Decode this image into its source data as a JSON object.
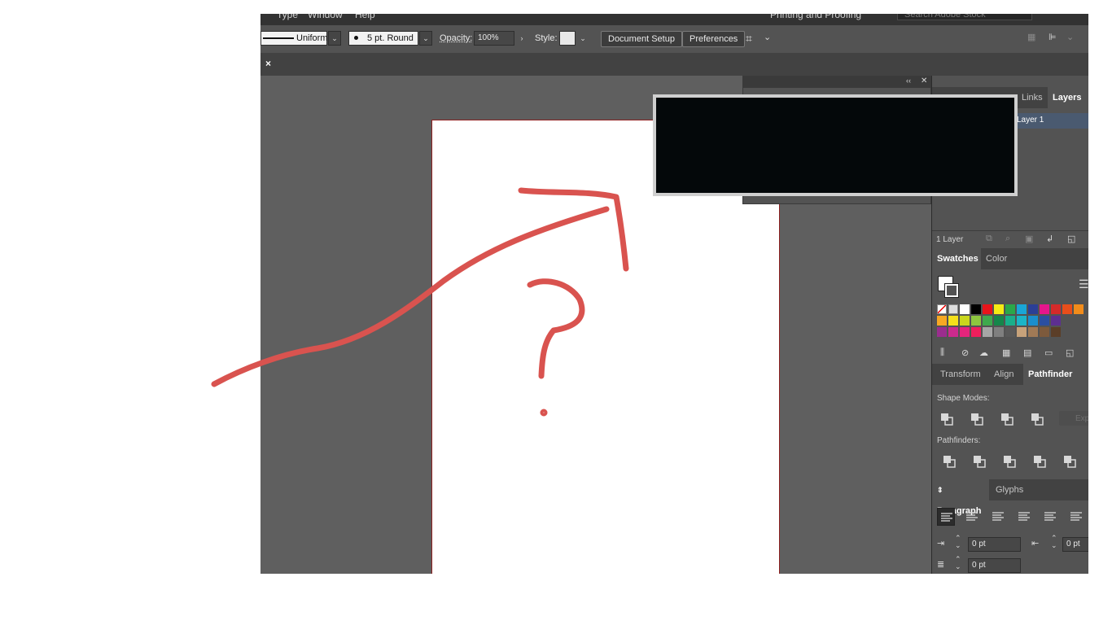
{
  "menubar": {
    "items": [
      "Type",
      "Window",
      "Help"
    ],
    "workspace": "Printing and Proofing",
    "search_placeholder": "Search Adobe Stock"
  },
  "control": {
    "stroke_profile": "Uniform",
    "brush": "5 pt. Round",
    "opacity_label": "Opacity:",
    "opacity_value": "100%",
    "style_label": "Style:",
    "document_setup": "Document Setup",
    "preferences": "Preferences"
  },
  "document_tab": {
    "close": "×"
  },
  "layers_panel": {
    "tabs": [
      "Links",
      "Layers"
    ],
    "layer_name": "Layer 1",
    "footer": "1 Layer"
  },
  "swatches_panel": {
    "tabs": [
      "Swatches",
      "Color"
    ]
  },
  "pathfinder_panel": {
    "tabs": [
      "Transform",
      "Align",
      "Pathfinder"
    ],
    "shape_modes_label": "Shape Modes:",
    "expand": "Expand",
    "pathfinders_label": "Pathfinders:"
  },
  "paragraph_panel": {
    "tabs": [
      "Paragraph",
      "Glyphs"
    ],
    "left_indent": "0 pt",
    "right_indent": "0 pt",
    "first_line_indent": "0 pt"
  },
  "colors": {
    "annotation": "#d9534f",
    "swatch_row1": [
      "#ffffff",
      "#000000",
      "#e8141b",
      "#f6eb14",
      "#2aa84a",
      "#1aa6d6",
      "#2b3f96",
      "#e6168c",
      "#d42a2a",
      "#e84e1b",
      "#f28c1b"
    ],
    "swatch_row2": [
      "#f7a823",
      "#f5e01a",
      "#cad71d",
      "#8dc63f",
      "#3ea94d",
      "#15864a",
      "#1aaf8a",
      "#1bb5c7",
      "#1a8ecd",
      "#2b4fa1",
      "#5d2f91"
    ],
    "swatch_row3": [
      "#9b2d8e",
      "#cc2a8d",
      "#e4257c",
      "#ee1f5c",
      "#a6a6a6",
      "#7f7f7f",
      "#595959",
      "#c7a27a",
      "#a07a56",
      "#7d5a3c",
      "#5b3e28"
    ]
  }
}
